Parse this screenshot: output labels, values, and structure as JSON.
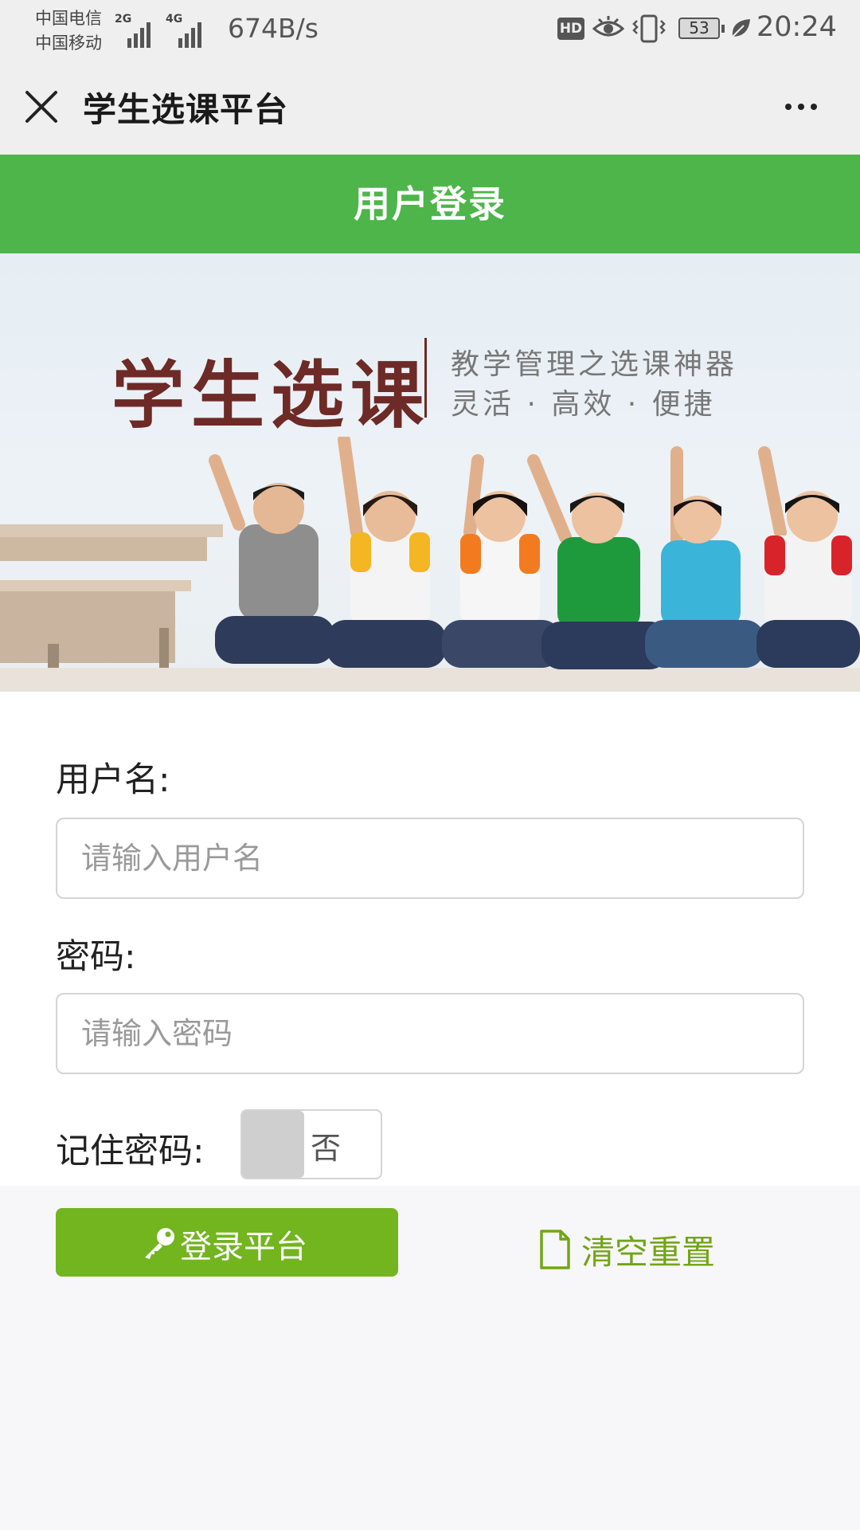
{
  "status_bar": {
    "carrier_1": "中国电信",
    "carrier_2": "中国移动",
    "signal_1_tag": "2G",
    "signal_2_tag": "4G",
    "net_speed": "674B/s",
    "hd_badge": "HD",
    "battery_level": "53",
    "time": "20:24"
  },
  "nav": {
    "title": "学生选课平台",
    "close_icon": "close-icon",
    "more_icon": "more-dots-icon"
  },
  "header": {
    "title": "用户登录",
    "color": "#4db54a"
  },
  "banner": {
    "title": "学生选课",
    "subtitle_line1": "教学管理之选课神器",
    "subtitle_line2": "灵活 · 高效 · 便捷",
    "title_color": "#6d2a26"
  },
  "form": {
    "username_label": "用户名:",
    "username_placeholder": "请输入用户名",
    "password_label": "密码:",
    "password_placeholder": "请输入密码",
    "remember_label": "记住密码:",
    "remember_toggle_text": "否"
  },
  "actions": {
    "login_label": "登录平台",
    "login_icon": "key-icon",
    "login_color": "#72b51f",
    "reset_label": "清空重置",
    "reset_icon": "file-icon",
    "reset_color": "#72a516"
  }
}
